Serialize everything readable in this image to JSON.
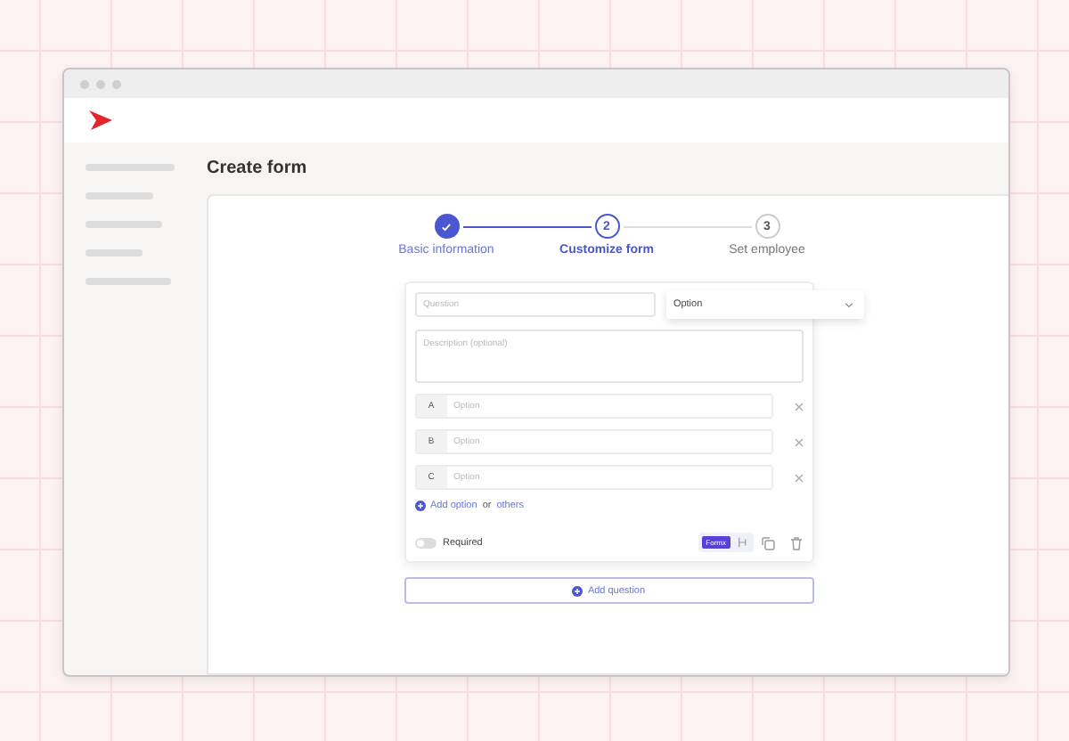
{
  "page": {
    "title": "Create form"
  },
  "steps": [
    {
      "label": "Basic information",
      "completed": true,
      "selected": false
    },
    {
      "number": "2",
      "label": "Customize form",
      "completed": false,
      "selected": true
    },
    {
      "number": "3",
      "label": "Set employee",
      "completed": false,
      "selected": false
    }
  ],
  "question": {
    "placeholder": "Question",
    "type_value": "Option",
    "description_placeholder": "Description (optional)"
  },
  "options": [
    {
      "letter": "A",
      "placeholder": "Option"
    },
    {
      "letter": "B",
      "placeholder": "Option"
    },
    {
      "letter": "C",
      "placeholder": "Option"
    }
  ],
  "add_option": {
    "link": "Add option",
    "joiner": "or",
    "others": "others"
  },
  "required": {
    "label": "Required",
    "on": false
  },
  "badge": "Formx",
  "add_question": "Add question"
}
